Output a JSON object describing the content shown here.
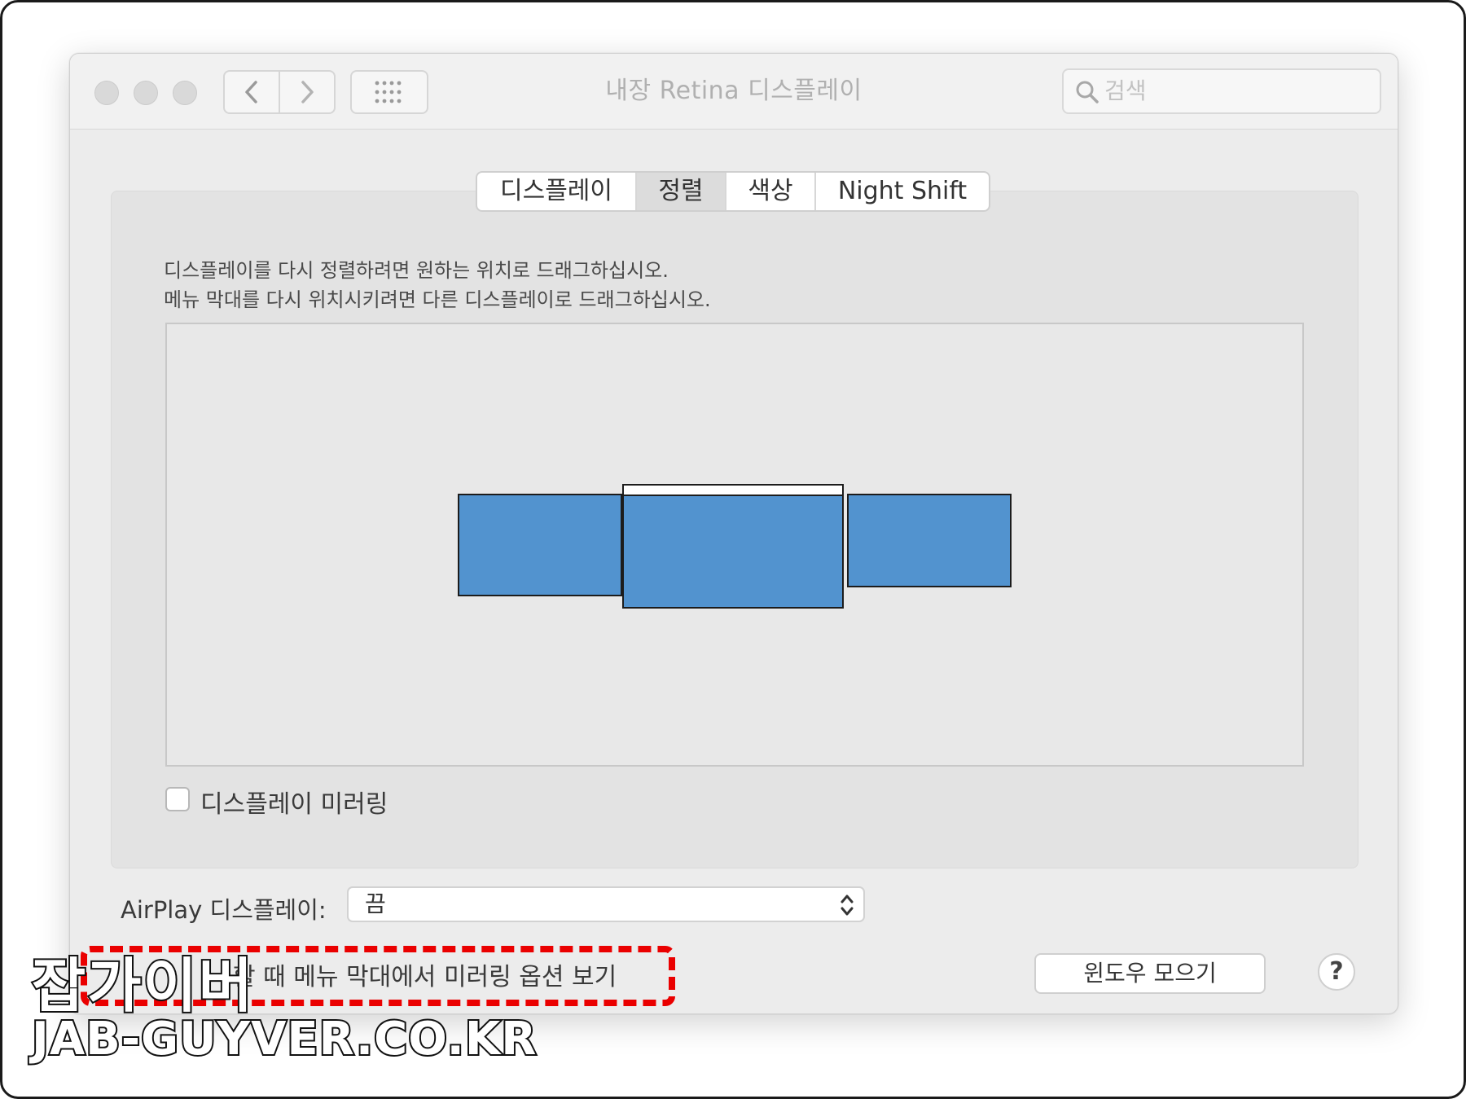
{
  "window": {
    "title": "내장 Retina 디스플레이",
    "search_placeholder": "검색"
  },
  "icons": {
    "back": "chevron-left-icon",
    "forward": "chevron-right-icon",
    "grid": "grid-dots-icon",
    "search": "magnifier-icon",
    "stepper": "up-down-chevron-icon"
  },
  "tabs": [
    {
      "label": "디스플레이",
      "selected": false
    },
    {
      "label": "정렬",
      "selected": true
    },
    {
      "label": "색상",
      "selected": false
    },
    {
      "label": "Night Shift",
      "selected": false
    }
  ],
  "instructions": {
    "line1": "디스플레이를 다시 정렬하려면 원하는 위치로 드래그하십시오.",
    "line2": "메뉴 막대를 다시 위치시키려면 다른 디스플레이로 드래그하십시오."
  },
  "arrangement": {
    "display_color": "#5293cf",
    "display_count": 3,
    "menu_bar_display": "center"
  },
  "mirroring": {
    "label": "디스플레이 미러링",
    "checked": false
  },
  "airplay": {
    "label": "AirPlay 디스플레이:",
    "value": "끔"
  },
  "menu_option": {
    "label_visible": "할 때 메뉴 막대에서 미러링 옵션 보기",
    "highlight_color": "#ea0000"
  },
  "buttons": {
    "gather_windows": "윈도우 모으기",
    "help": "?"
  },
  "watermark": {
    "name": "잡가이버",
    "url": "JAB-GUYVER.CO.KR"
  }
}
